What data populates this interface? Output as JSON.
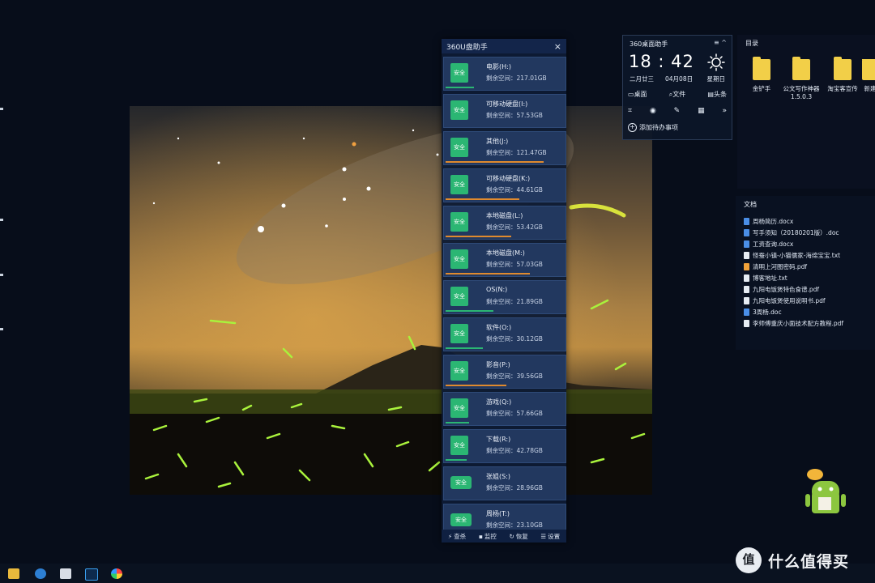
{
  "usb_panel": {
    "title": "360U盘助手",
    "close_icon": "×",
    "drives": [
      {
        "badge": "安全",
        "name": "电影(H:)",
        "space_label": "剩余空间：217.01GB",
        "used_fraction": 0.27,
        "bar_color": "#2bb673",
        "kind": "disk"
      },
      {
        "badge": "安全",
        "name": "可移动硬盘(I:)",
        "space_label": "剩余空间：57.53GB",
        "used_fraction": 0.0,
        "bar_color": "#2bb673",
        "kind": "disk"
      },
      {
        "badge": "安全",
        "name": "其他(J:)",
        "space_label": "剩余空间：121.47GB",
        "used_fraction": 0.93,
        "bar_color": "#e08a2e",
        "kind": "disk"
      },
      {
        "badge": "安全",
        "name": "可移动硬盘(K:)",
        "space_label": "剩余空间：44.61GB",
        "used_fraction": 0.7,
        "bar_color": "#e08a2e",
        "kind": "disk"
      },
      {
        "badge": "安全",
        "name": "本地磁盘(L:)",
        "space_label": "剩余空间：53.42GB",
        "used_fraction": 0.62,
        "bar_color": "#e08a2e",
        "kind": "disk"
      },
      {
        "badge": "安全",
        "name": "本地磁盘(M:)",
        "space_label": "剩余空间：57.03GB",
        "used_fraction": 0.8,
        "bar_color": "#e08a2e",
        "kind": "disk"
      },
      {
        "badge": "安全",
        "name": "OS(N:)",
        "space_label": "剩余空间：21.89GB",
        "used_fraction": 0.45,
        "bar_color": "#2bb673",
        "kind": "disk"
      },
      {
        "badge": "安全",
        "name": "软件(O:)",
        "space_label": "剩余空间：30.12GB",
        "used_fraction": 0.35,
        "bar_color": "#2bb673",
        "kind": "disk"
      },
      {
        "badge": "安全",
        "name": "影音(P:)",
        "space_label": "剩余空间：39.56GB",
        "used_fraction": 0.58,
        "bar_color": "#e08a2e",
        "kind": "disk"
      },
      {
        "badge": "安全",
        "name": "游戏(Q:)",
        "space_label": "剩余空间：57.66GB",
        "used_fraction": 0.22,
        "bar_color": "#2bb673",
        "kind": "disk"
      },
      {
        "badge": "安全",
        "name": "下载(R:)",
        "space_label": "剩余空间：42.78GB",
        "used_fraction": 0.2,
        "bar_color": "#2bb673",
        "kind": "disk"
      },
      {
        "badge": "安全",
        "name": "张姐(S:)",
        "space_label": "剩余空间：28.96GB",
        "used_fraction": 0.0,
        "bar_color": "#2bb673",
        "kind": "usb"
      },
      {
        "badge": "安全",
        "name": "周杨(T:)",
        "space_label": "剩余空间：23.10GB",
        "used_fraction": 0.2,
        "bar_color": "#2bb673",
        "kind": "usb"
      }
    ],
    "footer": {
      "scan": "查杀",
      "monitor": "监控",
      "restore": "恢复",
      "settings": "设置"
    }
  },
  "desk_widget": {
    "title": "360桌面助手",
    "time": "18 : 42",
    "lunar": "二月廿三",
    "date": "04月08日",
    "weekday": "星期日",
    "row1": {
      "desktop": "桌面",
      "file": "文件",
      "headline": "头条"
    },
    "todo": "添加待办事项"
  },
  "folders_panel": {
    "title": "目录",
    "folders": [
      {
        "label": "金铲手"
      },
      {
        "label": "公文写作神器 1.5.0.3"
      },
      {
        "label": "淘宝客宣传"
      },
      {
        "label": "新建"
      }
    ]
  },
  "docs_panel": {
    "title": "文档",
    "docs": [
      {
        "name": "周杨简历.docx",
        "color": "#4a8ee6"
      },
      {
        "name": "写手须知（20180201版）.doc",
        "color": "#4a8ee6"
      },
      {
        "name": "工资查询.docx",
        "color": "#4a8ee6"
      },
      {
        "name": "怪蚕小镇-小猫儒家-海绵宝宝.txt",
        "color": "#e6ecf3"
      },
      {
        "name": "清明上河图密码.pdf",
        "color": "#f0a23a"
      },
      {
        "name": "博客地址.txt",
        "color": "#e6ecf3"
      },
      {
        "name": "九阳电饭煲特色食谱.pdf",
        "color": "#e6ecf3"
      },
      {
        "name": "九阳电饭煲使用说明书.pdf",
        "color": "#e6ecf3"
      },
      {
        "name": "3周杨.doc",
        "color": "#4a8ee6"
      },
      {
        "name": "李师傅重庆小面技术配方教程.pdf",
        "color": "#e6ecf3"
      }
    ]
  },
  "watermark": {
    "logo": "值",
    "text": "什么值得买"
  },
  "taskbar_icons": [
    "folder-icon",
    "edge-icon",
    "notepad-icon",
    "photoshop-icon",
    "color-wheel-icon"
  ]
}
